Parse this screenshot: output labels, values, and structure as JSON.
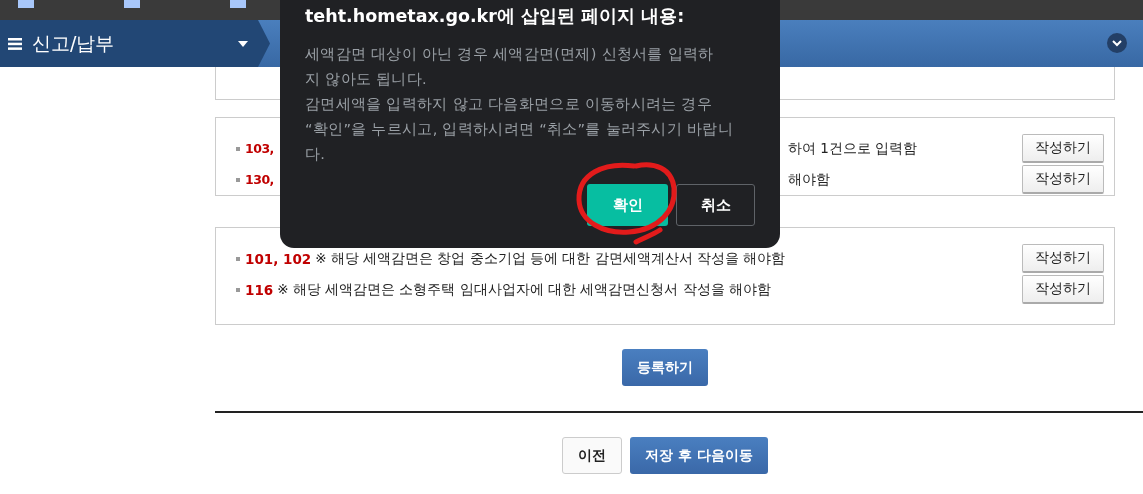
{
  "nav": {
    "menu_label": "신고/납부"
  },
  "cards": [
    {
      "rows": [
        {
          "kind": "partial",
          "code": "103,",
          "text": "하여 1건으로 입력함",
          "button": "작성하기"
        },
        {
          "kind": "partial",
          "code": "130,",
          "text": "해야함",
          "button": "작성하기"
        }
      ]
    },
    {
      "rows": [
        {
          "kind": "full",
          "code": "101, 102",
          "text": "※ 해당 세액감면은 창업 중소기업 등에 대한 감면세액계산서 작성을 해야함",
          "button": "작성하기"
        },
        {
          "kind": "full",
          "code": "116",
          "text": "※ 해당 세액감면은 소형주택 임대사업자에 대한 세액감면신청서 작성을 해야함",
          "button": "작성하기"
        }
      ]
    }
  ],
  "register_button": "등록하기",
  "footer_buttons": [
    {
      "label": "이전",
      "kind": "secondary"
    },
    {
      "label": "저장 후 다음이동",
      "kind": "primary"
    }
  ],
  "dialog": {
    "title": "teht.hometax.go.kr에 삽입된 페이지 내용:",
    "message_lines": [
      "세액감면 대상이 아닌 경우 세액감면(면제) 신청서를 입력하",
      "지 않아도 됩니다.",
      "감면세액을 입력하지 않고 다음화면으로 이동하시려는 경우",
      "“확인”을 누르시고, 입력하시려면 “취소”를 눌러주시기 바랍니",
      "다."
    ],
    "buttons": [
      {
        "label": "확인",
        "kind": "primary"
      },
      {
        "label": "취소",
        "kind": "secondary"
      }
    ]
  }
}
